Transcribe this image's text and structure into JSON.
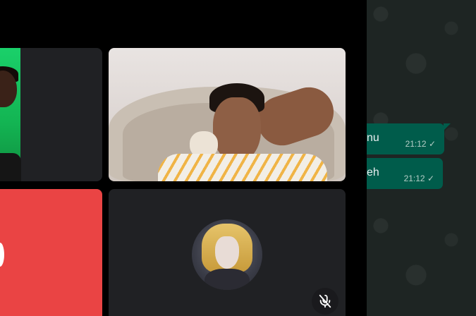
{
  "call": {
    "participants": [
      {
        "name_visible": false,
        "video": "on"
      },
      {
        "name_visible": false,
        "video": "on"
      },
      {
        "name_visible": false,
        "video": "off"
      },
      {
        "name_visible": false,
        "video": "off",
        "avatar": "anime-avatar",
        "muted": true
      }
    ],
    "mute_icon": "mic-off-icon",
    "colors": {
      "tile_bg": "#202124",
      "red_tile": "#ea4444",
      "green_bg": "#13b553"
    }
  },
  "chat": {
    "messages": [
      {
        "text": "nu",
        "time": "21:12",
        "status": "sent-check"
      },
      {
        "text": "eh",
        "time": "21:12",
        "status": "sent-check"
      }
    ],
    "colors": {
      "bubble_out": "#005c4b",
      "bg": "#1e2523"
    }
  }
}
